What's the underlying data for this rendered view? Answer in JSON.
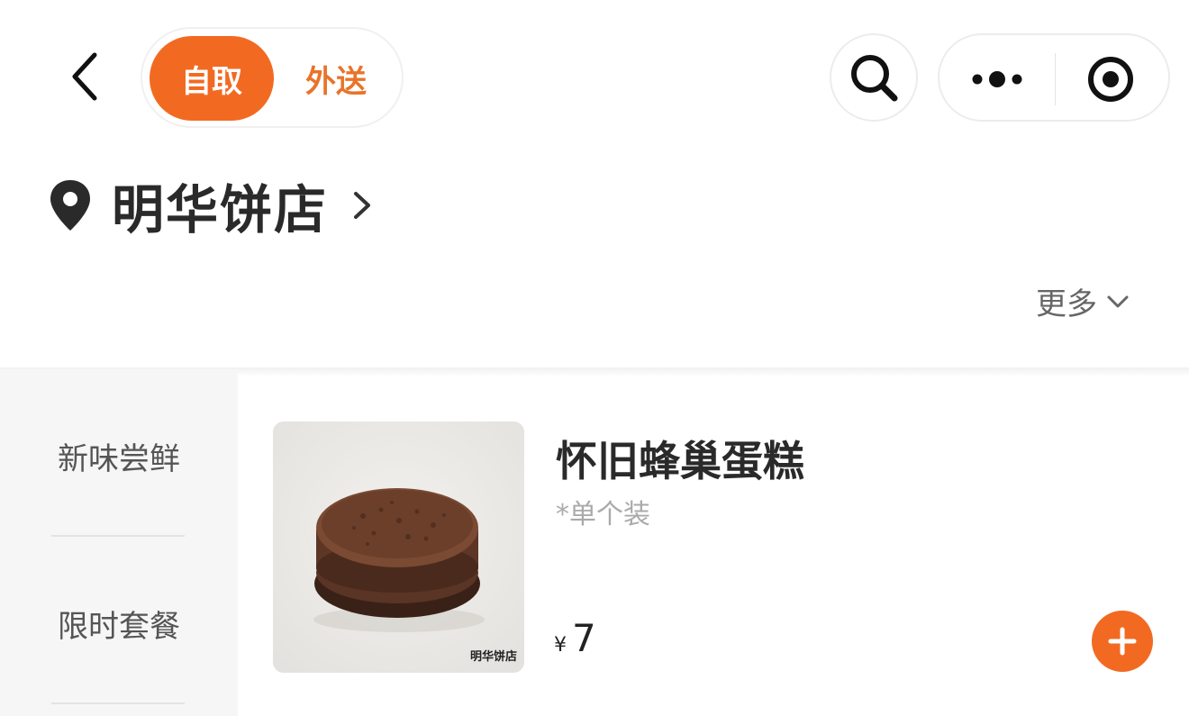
{
  "header": {
    "mode_toggle": {
      "pickup_label": "自取",
      "delivery_label": "外送",
      "selected": "pickup"
    }
  },
  "store": {
    "name": "明华饼店"
  },
  "filter": {
    "more_label": "更多"
  },
  "sidebar": {
    "items": [
      {
        "label": "新味尝鲜"
      },
      {
        "label": "限时套餐"
      }
    ]
  },
  "product": {
    "name": "怀旧蜂巢蛋糕",
    "description": "*单个装",
    "currency": "¥",
    "price": "7",
    "watermark": "明华饼店"
  },
  "colors": {
    "accent": "#f26a22",
    "delivery_text": "#e8742a",
    "sidebar_bg": "#f6f6f6"
  },
  "icons": [
    "back-arrow-icon",
    "search-icon",
    "more-dots-icon",
    "target-icon",
    "location-pin-icon",
    "chevron-right-icon",
    "chevron-down-icon",
    "plus-icon"
  ]
}
